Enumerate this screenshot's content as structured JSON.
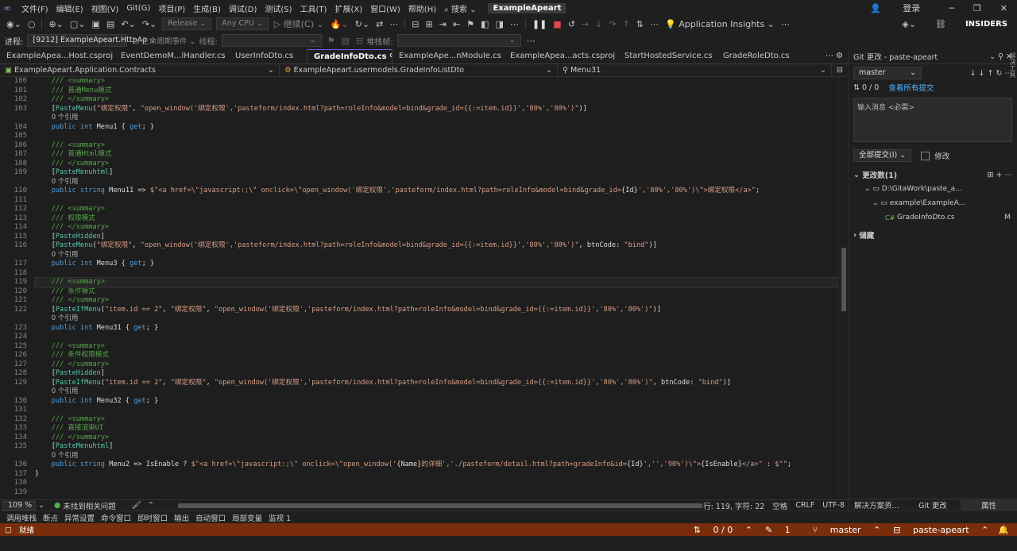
{
  "menu": {
    "items": [
      "文件(F)",
      "编辑(E)",
      "视图(V)",
      "Git(G)",
      "项目(P)",
      "生成(B)",
      "调试(D)",
      "测试(S)",
      "工具(T)",
      "扩展(X)",
      "窗口(W)",
      "帮助(H)"
    ],
    "search": "搜索",
    "project": "ExampleApeart",
    "login": "登录"
  },
  "toolbar": {
    "config": "Release",
    "platform": "Any CPU",
    "continue": "继续(C)",
    "insights": "Application Insights",
    "insiders": "INSIDERS"
  },
  "procbar": {
    "process_label": "进程:",
    "process_value": "[9212] ExampleApeart.HttpAp",
    "lifecycle": "生命周期事件",
    "thread_label": "线程:",
    "stack_label": "堆栈帧:"
  },
  "tabs": [
    "ExampleApea...Host.csproj",
    "EventDemoM...lHandler.cs",
    "UserInfoDto.cs",
    "GradeInfoDto.cs",
    "ExampleApe...nModule.cs",
    "ExampleApea...acts.csproj",
    "StartHostedService.cs",
    "GradeRoleDto.cs"
  ],
  "navbar": {
    "project": "ExampleApeart.Application.Contracts",
    "class": "ExampleApeart.usermodels.GradeInfoListDto",
    "member": "Menu31"
  },
  "code": {
    "line_numbers": [
      "100",
      "101",
      "102",
      "103",
      "",
      "104",
      "105",
      "106",
      "107",
      "108",
      "109",
      "",
      "110",
      "111",
      "112",
      "113",
      "114",
      "115",
      "116",
      "",
      "117",
      "118",
      "119",
      "120",
      "121",
      "122",
      "",
      "123",
      "124",
      "125",
      "126",
      "127",
      "128",
      "129",
      "",
      "130",
      "131",
      "132",
      "133",
      "134",
      "135",
      "",
      "136",
      "137",
      "138",
      "139"
    ]
  },
  "editor_status": {
    "zoom": "109 %",
    "issues": "未找到相关问题",
    "position": "行: 119, 字符: 22",
    "spaces": "空格",
    "eol": "CRLF",
    "encoding": "UTF-8"
  },
  "git": {
    "title": "Git 更改 - paste-apeart",
    "branch": "master",
    "sync": "0 / 0",
    "view_all": "查看所有提交",
    "message_placeholder": "输入消息 <必需>",
    "commit_all": "全部提交(I)",
    "amend": "修改",
    "changes": "更改数(1)",
    "repo_path": "D:\\GitaWork\\paste_a...",
    "folder": "example\\ExampleA...",
    "file": "GradeInfoDto.cs",
    "file_status": "M",
    "stash": "储藏"
  },
  "right_tabs": [
    "解决方案资...",
    "Git 更改",
    "属性"
  ],
  "lower_tabs": [
    "调用堆栈",
    "断点",
    "异常设置",
    "命令窗口",
    "即时窗口",
    "输出",
    "自动窗口",
    "局部变量",
    "监视 1"
  ],
  "statusbar": {
    "ready": "就绪",
    "sync": "0 / 0",
    "commits": "1",
    "branch": "master",
    "repo": "paste-apeart"
  },
  "side_label": "解决工具"
}
